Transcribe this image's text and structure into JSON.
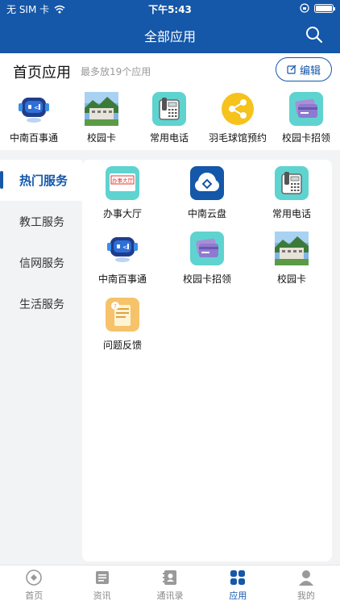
{
  "status_bar": {
    "carrier": "无 SIM 卡",
    "time": "下午5:43"
  },
  "header": {
    "title": "全部应用"
  },
  "home_apps": {
    "title": "首页应用",
    "subtitle": "最多放19个应用",
    "edit_label": "编辑",
    "items": [
      {
        "label": "中南百事通",
        "icon": "robot-icon"
      },
      {
        "label": "校园卡",
        "icon": "campus-photo-icon"
      },
      {
        "label": "常用电话",
        "icon": "phone-icon"
      },
      {
        "label": "羽毛球馆预约",
        "icon": "share-icon"
      },
      {
        "label": "校园卡招领",
        "icon": "card-icon"
      }
    ]
  },
  "categories": [
    {
      "label": "热门服务",
      "active": true
    },
    {
      "label": "教工服务"
    },
    {
      "label": "信网服务"
    },
    {
      "label": "生活服务"
    }
  ],
  "apps": [
    {
      "label": "办事大厅",
      "icon": "office-hall-icon",
      "badge_text": "办事大厅"
    },
    {
      "label": "中南云盘",
      "icon": "cloud-disk-icon"
    },
    {
      "label": "常用电话",
      "icon": "phone-icon"
    },
    {
      "label": "中南百事通",
      "icon": "robot-icon"
    },
    {
      "label": "校园卡招领",
      "icon": "card-icon"
    },
    {
      "label": "校园卡",
      "icon": "campus-photo-icon"
    },
    {
      "label": "问题反馈",
      "icon": "feedback-icon"
    }
  ],
  "tabbar": [
    {
      "label": "首页"
    },
    {
      "label": "资讯"
    },
    {
      "label": "通讯录"
    },
    {
      "label": "应用",
      "active": true
    },
    {
      "label": "我的"
    }
  ],
  "colors": {
    "primary": "#1557a8",
    "teal": "#5fd3d0",
    "yellow": "#f6c21c",
    "bg": "#f2f3f5"
  }
}
